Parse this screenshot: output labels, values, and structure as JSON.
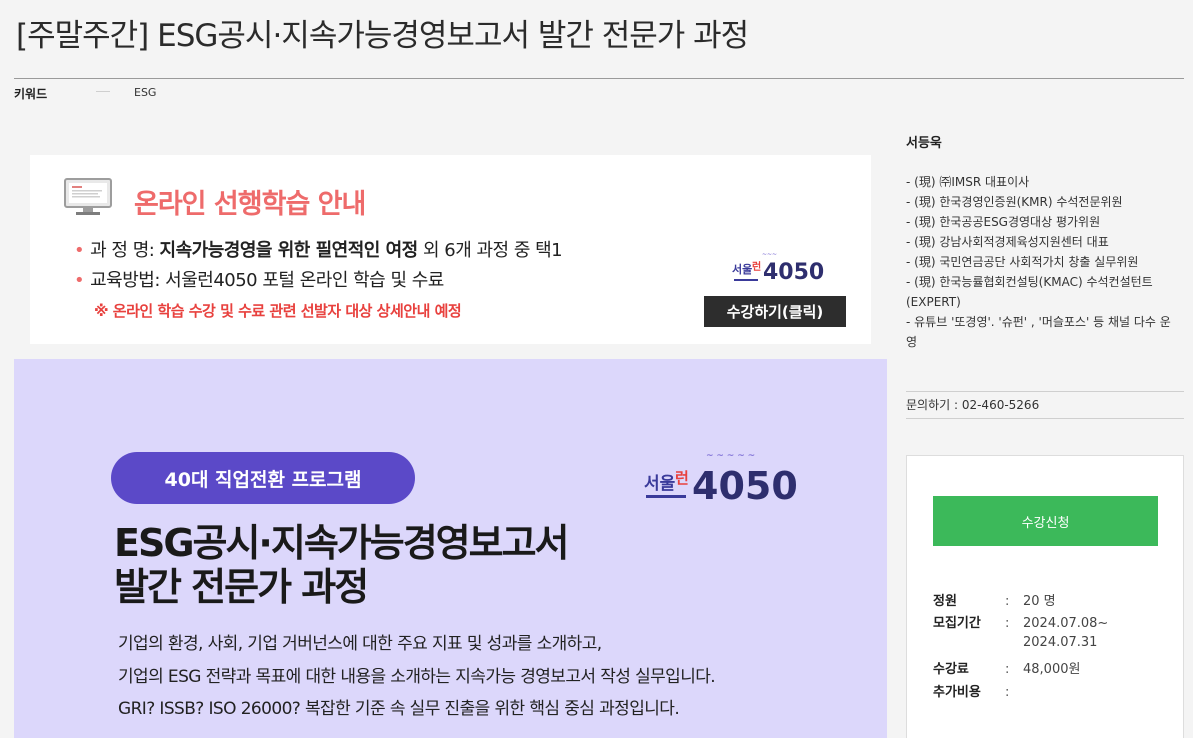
{
  "page": {
    "title": "[주말주간] ESG공시·지속가능경영보고서 발간 전문가 과정",
    "keyword_label": "키워드",
    "keyword_value": "ESG"
  },
  "promo": {
    "heading": "온라인 선행학습 안내",
    "line1_label": "과 정 명: ",
    "line1_bold": "지속가능경영을 위한 필연적인 여정",
    "line1_rest": " 외 6개 과정 중 택1",
    "line2": "교육방법: 서울런4050 포털 온라인 학습 및 수료",
    "note": "※ 온라인 학습 수강 및 수료 관련 선발자 대상 상세안내 예정",
    "button": "수강하기(클릭)",
    "bullet": "•"
  },
  "banner": {
    "pill": "40대 직업전환 프로그램",
    "title_line1": "ESG공시·지속가능경영보고서",
    "title_line2": "발간 전문가 과정",
    "desc1": "기업의 환경, 사회, 기업 거버넌스에 대한 주요 지표 및 성과를 소개하고,",
    "desc2": "기업의 ESG 전략과 목표에 대한 내용을 소개하는 지속가능 경영보고서 작성 실무입니다.",
    "desc3": "GRI? ISSB? ISO 26000?  복잡한 기준 속 실무 진출을 위한 핵심 중심 과정입니다."
  },
  "instructor": {
    "name": "서등욱",
    "bio": [
      "- (現) ㈜IMSR 대표이사",
      "- (現) 한국경영인증원(KMR) 수석전문위원",
      "- (現) 한국공공ESG경영대상 평가위원",
      "- (現) 강남사회적경제육성지원센터 대표",
      "- (現) 국민연금공단 사회적가치 창출 실무위원",
      "- (現) 한국능률협회컨설팅(KMAC) 수석컨설턴트(EXPERT)",
      "- 유튜브 '또경영'. '슈펀' , '머슬포스' 등 채널 다수 운영"
    ],
    "contact": "문의하기 : 02-460-5266"
  },
  "apply": {
    "button": "수강신청",
    "capacity_label": "정원",
    "capacity_value": "20 명",
    "period_label": "모집기간",
    "period_start": "2024.07.08~",
    "period_end": "2024.07.31",
    "fee_label": "수강료",
    "fee_value": "48,000원",
    "extra_label": "추가비용",
    "extra_value": "",
    "colon": ":"
  },
  "colors": {
    "accent_green": "#3cb95a",
    "banner_bg": "#dcd7fb",
    "pill_purple": "#5b49c8",
    "promo_red": "#ee6b6b"
  }
}
